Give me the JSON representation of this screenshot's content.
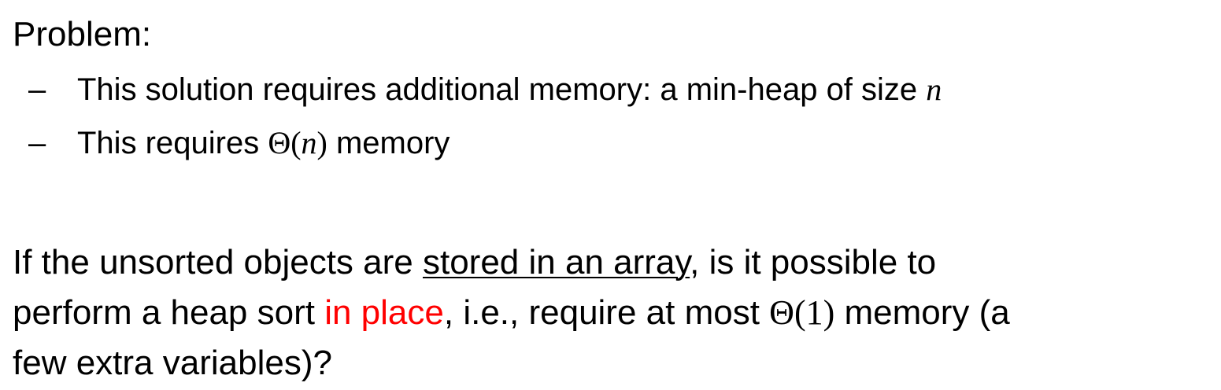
{
  "heading": "Problem:",
  "bullets": [
    {
      "dash": "–",
      "text": "This solution requires additional memory: a min-heap of size ",
      "math_var": "n"
    },
    {
      "dash": "–",
      "text_before": "This requires ",
      "math_theta": "Θ",
      "math_open": "(",
      "math_var": "n",
      "math_close": ")",
      "text_after": " memory"
    }
  ],
  "paragraph": {
    "line1_before": "If the unsorted objects are ",
    "line1_underlined": "stored in an array",
    "line1_after": ", is it possible to",
    "line2_before": "perform a heap sort ",
    "line2_emphasis": "in place",
    "line2_middle": ", i.e., require at most ",
    "line2_math_theta": "Θ",
    "line2_math_arg": "(1)",
    "line2_after": " memory (a",
    "line3": "few extra variables)?"
  },
  "colors": {
    "text": "#000000",
    "emphasis": "#ff0000",
    "background": "#ffffff"
  }
}
